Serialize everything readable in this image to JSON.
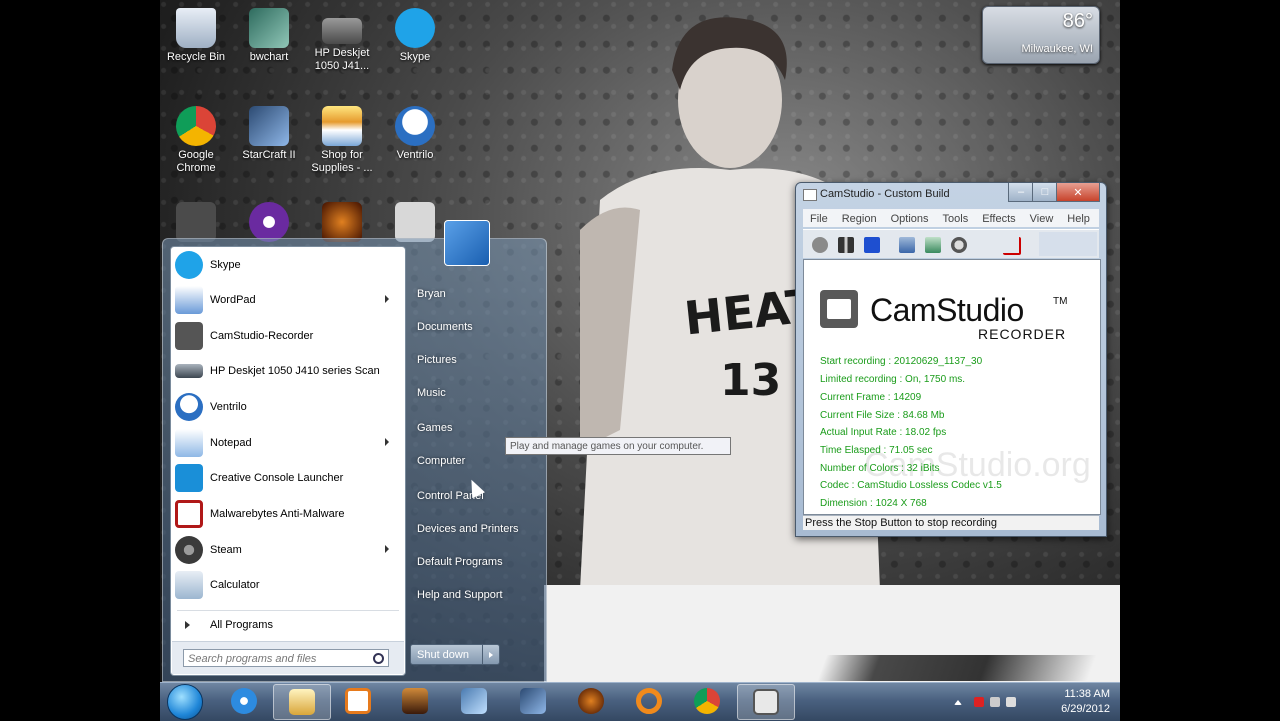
{
  "desktop": {
    "icons": [
      {
        "name": "recycle-bin-icon",
        "label": "Recycle Bin"
      },
      {
        "name": "bwchart-icon",
        "label": "bwchart"
      },
      {
        "name": "hp-deskjet-icon",
        "label": "HP Deskjet 1050 J41..."
      },
      {
        "name": "skype-icon",
        "label": "Skype"
      },
      {
        "name": "google-chrome-icon",
        "label": "Google Chrome"
      },
      {
        "name": "starcraft-icon",
        "label": "StarCraft II"
      },
      {
        "name": "shop-supplies-icon",
        "label": "Shop for Supplies - ..."
      },
      {
        "name": "ventrilo-icon",
        "label": "Ventrilo"
      }
    ],
    "weather": {
      "temp": "86°",
      "city": "Milwaukee, WI"
    }
  },
  "start_menu": {
    "pinned": [
      {
        "label": "Skype",
        "icon": "skype-icon",
        "submenu": false,
        "color": "#1fa3e8"
      },
      {
        "label": "WordPad",
        "icon": "wordpad-icon",
        "submenu": true,
        "color": "#6a9ad8"
      },
      {
        "label": "CamStudio-Recorder",
        "icon": "camstudio-icon",
        "submenu": false,
        "color": "#555555"
      },
      {
        "label": "HP Deskjet 1050 J410 series Scan",
        "icon": "scanner-icon",
        "submenu": false,
        "color": "#3c4650"
      },
      {
        "label": "Ventrilo",
        "icon": "ventrilo-icon",
        "submenu": false,
        "color": "#2b6fc2"
      },
      {
        "label": "Notepad",
        "icon": "notepad-icon",
        "submenu": true,
        "color": "#8fb8e6"
      },
      {
        "label": "Creative Console Launcher",
        "icon": "creative-icon",
        "submenu": false,
        "color": "#1a8fd8"
      },
      {
        "label": "Malwarebytes Anti-Malware",
        "icon": "malwarebytes-icon",
        "submenu": false,
        "color": "#b01818"
      },
      {
        "label": "Steam",
        "icon": "steam-icon",
        "submenu": true,
        "color": "#3a3a3a"
      },
      {
        "label": "Calculator",
        "icon": "calculator-icon",
        "submenu": false,
        "color": "#9cb6d0"
      }
    ],
    "all_programs": "All Programs",
    "search_placeholder": "Search programs and files",
    "right_items": [
      "Bryan",
      "Documents",
      "Pictures",
      "Music",
      "Games",
      "Computer",
      "Control Panel",
      "Devices and Printers",
      "Default Programs",
      "Help and Support"
    ],
    "shutdown": "Shut down",
    "tooltip": "Play and manage games on your computer."
  },
  "camstudio": {
    "title": "CamStudio - Custom Build",
    "menu": [
      "File",
      "Region",
      "Options",
      "Tools",
      "Effects",
      "View",
      "Help"
    ],
    "brand": "CamStudio",
    "trademark": "TM",
    "subtitle": "RECORDER",
    "stats": [
      "Start recording : 20120629_1137_30",
      "Limited recording : On, 1750 ms.",
      "Current Frame : 14209",
      "Current File Size : 84.68 Mb",
      "Actual Input Rate : 18.02 fps",
      "Time Elasped : 71.05 sec",
      "Number of Colors : 32 iBits",
      "Codec : CamStudio Lossless Codec v1.5",
      "Dimension : 1024 X 768"
    ],
    "watermark": "CamStudio.org",
    "status": "Press the Stop Button to stop recording",
    "colors": {
      "stats": "#1a9c1a"
    }
  },
  "taskbar": {
    "time": "11:38 AM",
    "date": "6/29/2012",
    "apps": [
      "windows-explorer",
      "internet-explorer",
      "file-explorer",
      "media-player",
      "diablo-3",
      "starcraft",
      "starcraft-2",
      "diablo",
      "origin",
      "google-chrome",
      "camstudio"
    ]
  }
}
